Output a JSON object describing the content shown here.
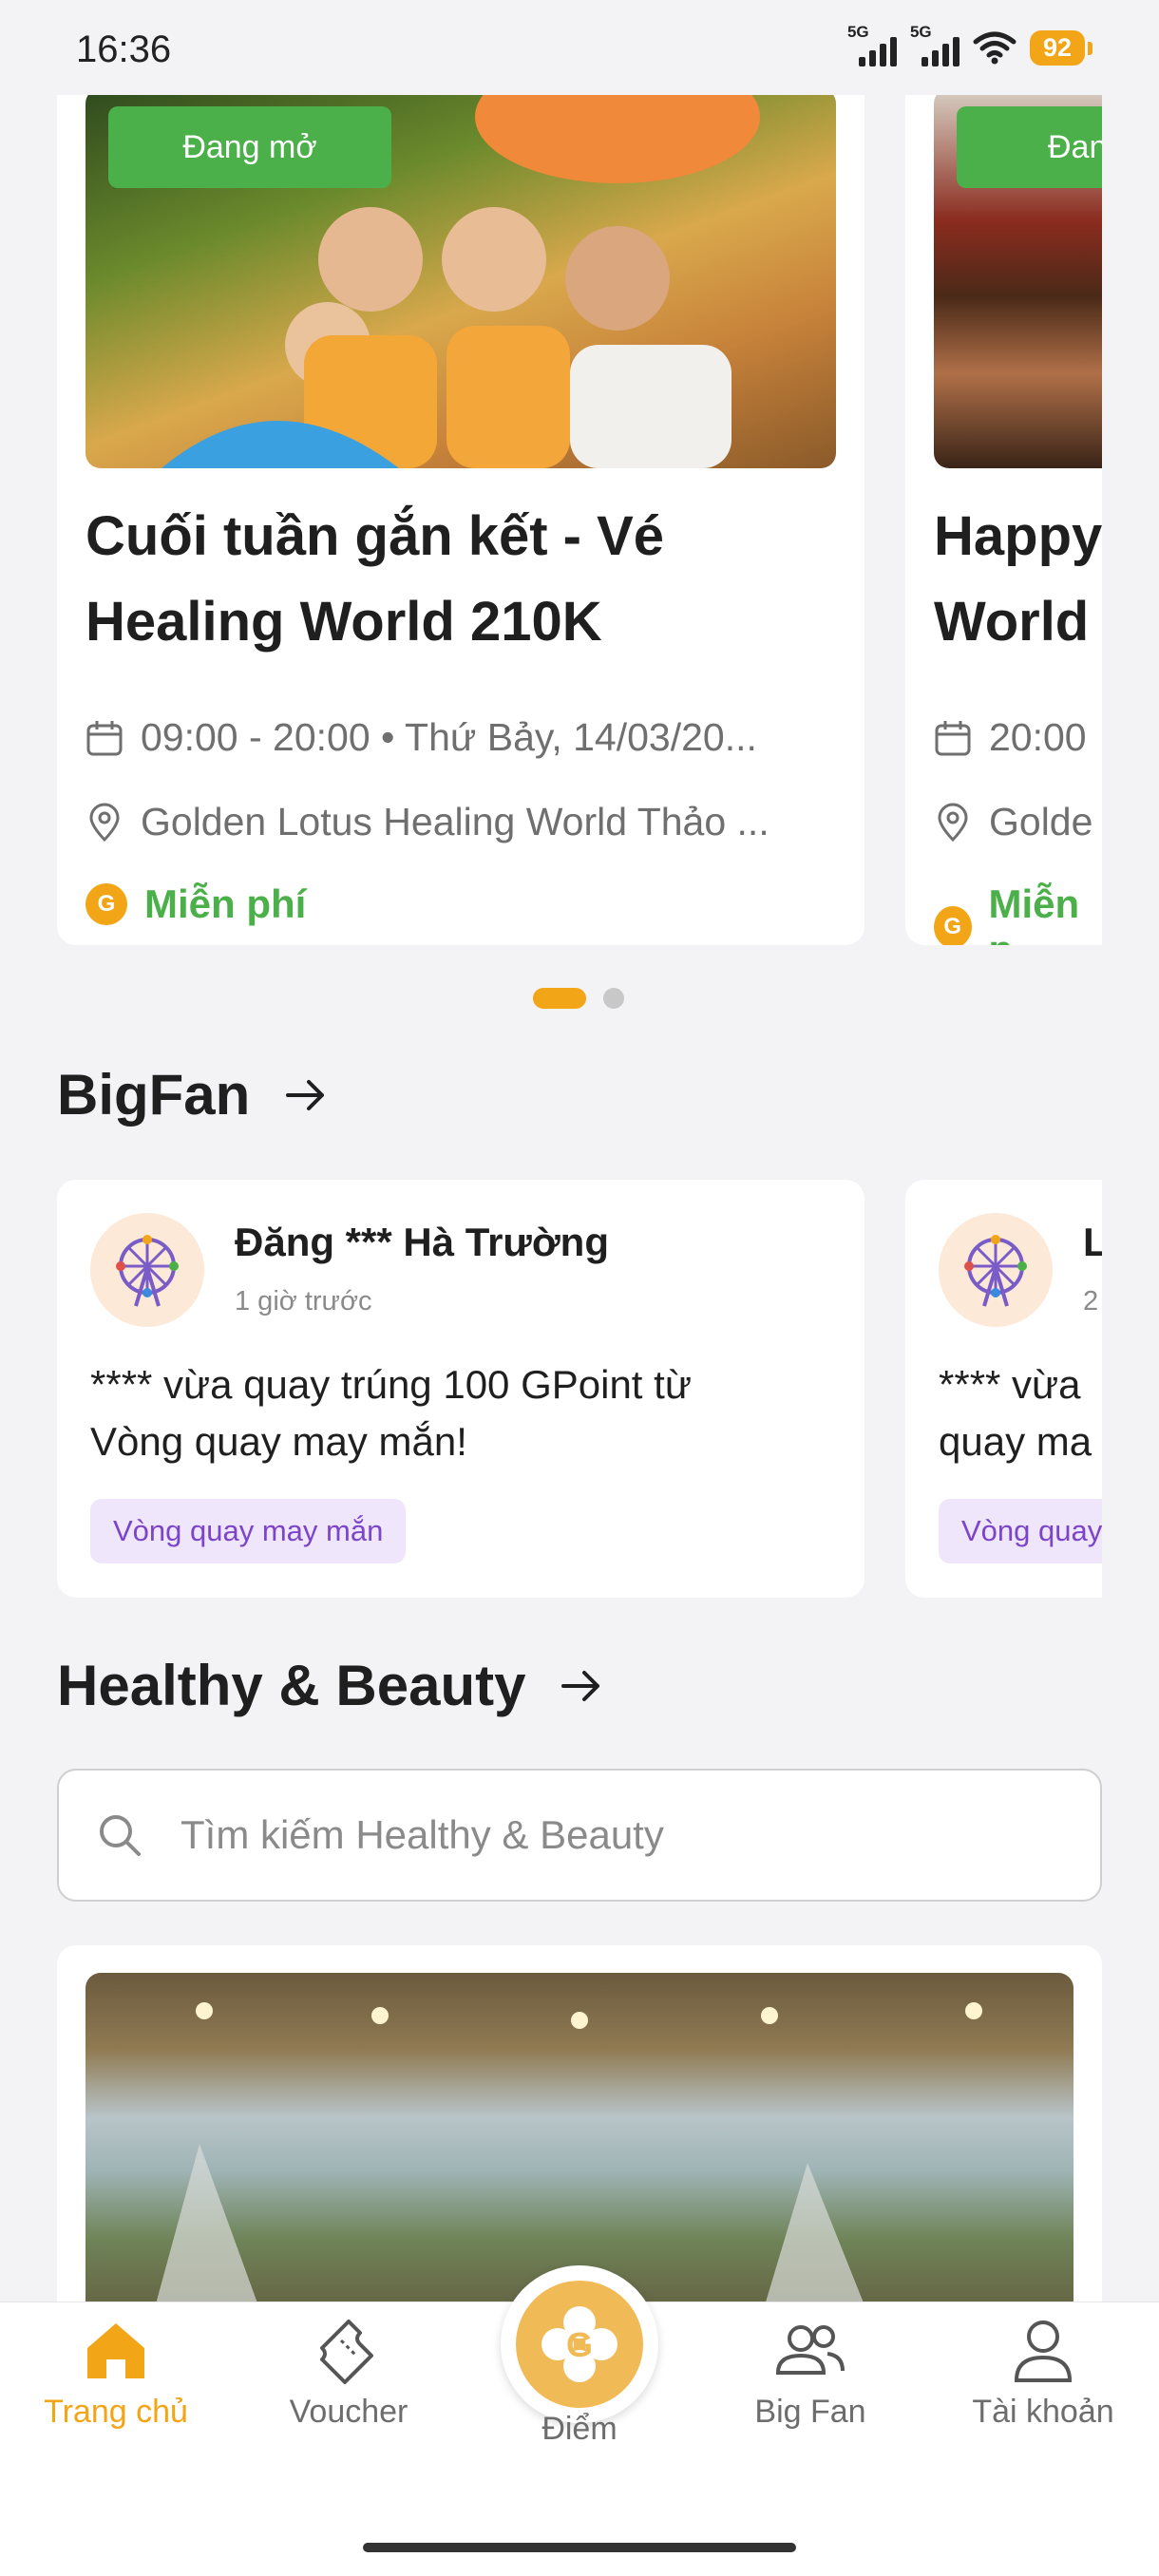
{
  "status_bar": {
    "time": "16:36",
    "network_1": "5G",
    "network_2": "5G",
    "battery": "92",
    "battery_color": "#f2a516"
  },
  "events": [
    {
      "badge": "Đang mở",
      "title": "Cuối tuần gắn kết - Vé Healing World 210K",
      "datetime": "09:00 - 20:00 • Thứ Bảy, 14/03/20...",
      "location": "Golden Lotus Healing World Thảo ...",
      "price": "Miễn phí"
    },
    {
      "badge": "Đang",
      "title": "Happy World",
      "datetime": "20:00",
      "location": "Golde",
      "price": "Miễn p"
    }
  ],
  "bigfan": {
    "heading": "BigFan",
    "posts": [
      {
        "name": "Đăng *** Hà Trường",
        "time": "1 giờ trước",
        "message": "**** vừa quay trúng 100 GPoint từ Vòng quay may mắn!",
        "tag": "Vòng quay may mắn"
      },
      {
        "name": "L",
        "time": "2",
        "message": "**** vừa quay ma",
        "tag": "Vòng quay"
      }
    ]
  },
  "healthy": {
    "heading": "Healthy & Beauty",
    "search_placeholder": "Tìm kiếm Healthy & Beauty"
  },
  "nav": {
    "home": "Trang chủ",
    "voucher": "Voucher",
    "points": "Điểm",
    "bigfan": "Big Fan",
    "account": "Tài khoản",
    "coin_letter": "G"
  },
  "colors": {
    "accent": "#f2a516",
    "success": "#4cb04a",
    "chip_text": "#7b45c9",
    "chip_bg": "#efe6fb"
  }
}
